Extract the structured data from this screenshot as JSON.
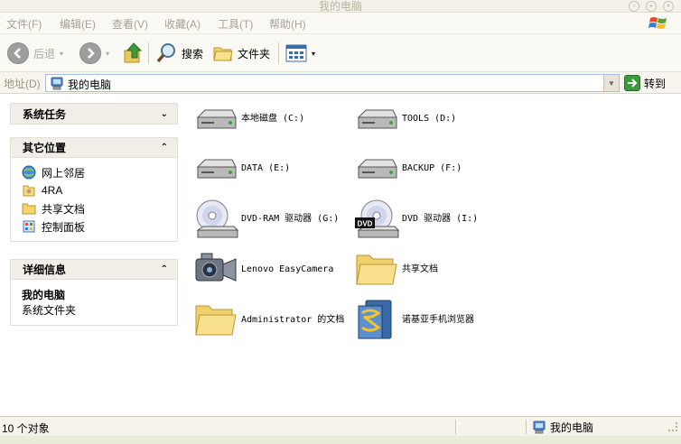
{
  "window": {
    "title": "我的电脑"
  },
  "menu": [
    "文件(F)",
    "编辑(E)",
    "查看(V)",
    "收藏(A)",
    "工具(T)",
    "帮助(H)"
  ],
  "toolbar": {
    "back": "后退",
    "search": "搜索",
    "folders": "文件夹"
  },
  "address": {
    "label": "地址(D)",
    "value": "我的电脑",
    "go": "转到"
  },
  "taskpane": {
    "system_tasks": "系统任务",
    "other_places": "其它位置",
    "other_links": [
      "网上邻居",
      "4RA",
      "共享文档",
      "控制面板"
    ],
    "details": "详细信息",
    "detail_name": "我的电脑",
    "detail_type": "系统文件夹"
  },
  "items": [
    {
      "name": "本地磁盘 (C:)",
      "icon": "hard-drive-icon"
    },
    {
      "name": "TOOLS (D:)",
      "icon": "hard-drive-icon"
    },
    {
      "name": "DATA (E:)",
      "icon": "hard-drive-icon"
    },
    {
      "name": "BACKUP (F:)",
      "icon": "hard-drive-icon"
    },
    {
      "name": "DVD-RAM 驱动器 (G:)",
      "icon": "dvd-drive-icon"
    },
    {
      "name": "DVD 驱动器 (I:)",
      "icon": "dvd-drive-icon"
    },
    {
      "name": "Lenovo EasyCamera",
      "icon": "camera-icon"
    },
    {
      "name": "共享文档",
      "icon": "folder-icon"
    },
    {
      "name": "Administrator 的文档",
      "icon": "folder-icon"
    },
    {
      "name": "诺基亚手机浏览器",
      "icon": "phone-browser-icon"
    }
  ],
  "dvd_badge": "DVD",
  "status": {
    "count": "10 个对象",
    "location": "我的电脑"
  }
}
